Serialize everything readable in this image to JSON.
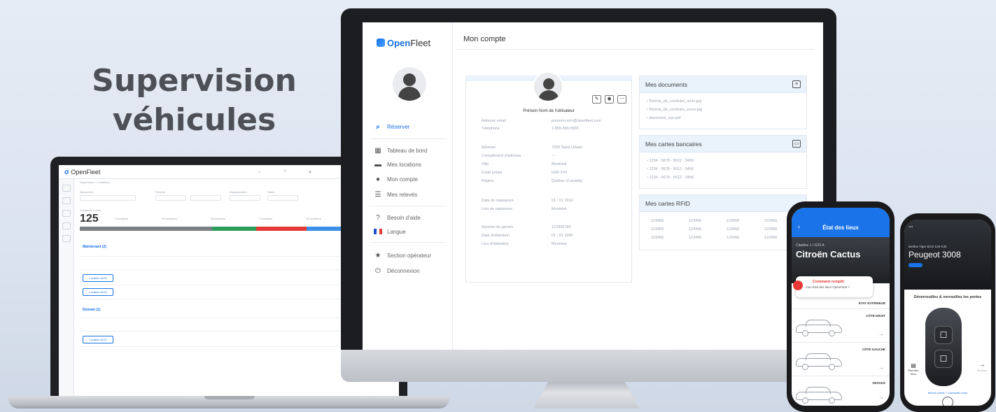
{
  "headline": {
    "line1": "Supervision",
    "line2": "véhicules"
  },
  "colors": {
    "accent": "#1a73e8",
    "danger": "#e53935",
    "text": "#4d5057"
  },
  "desktop": {
    "logo_prefix": "Open",
    "logo_suffix": "Fleet",
    "page_title": "Mon compte",
    "nav": [
      {
        "label": "Réserver",
        "icon": "search-icon"
      },
      {
        "label": "Tableau de bord",
        "icon": "dashboard-icon"
      },
      {
        "label": "Mes locations",
        "icon": "car-icon"
      },
      {
        "label": "Mon compte",
        "icon": "user-icon"
      },
      {
        "label": "Mes relevés",
        "icon": "list-icon"
      },
      {
        "label": "Besoin d'aide",
        "icon": "help-icon"
      },
      {
        "label": "Langue",
        "icon": "flag-icon"
      },
      {
        "label": "Section opérateur",
        "icon": "star-icon"
      },
      {
        "label": "Déconnexion",
        "icon": "power-icon"
      }
    ],
    "profile": {
      "name": "Prénom Nom de l'utilisateur",
      "fields": [
        {
          "label": "Adresse email",
          "value": "prenom.nom@openfleet.com"
        },
        {
          "label": "Téléphone",
          "value": "1-855-555-5555"
        },
        {
          "label": "Adresse",
          "value": "7200 Saint-Urbain"
        },
        {
          "label": "Complément d'adresse",
          "value": "—"
        },
        {
          "label": "Ville",
          "value": "Montréal"
        },
        {
          "label": "Code postal",
          "value": "H2R 2Y6"
        },
        {
          "label": "Région",
          "value": "Québec (Canada)"
        },
        {
          "label": "Date de naissance",
          "value": "01 / 01 1910"
        },
        {
          "label": "Lieu de naissance",
          "value": "Montréal"
        },
        {
          "label": "Numéro du permis",
          "value": "123456789"
        },
        {
          "label": "Date d'obtention",
          "value": "01 / 01 1990"
        },
        {
          "label": "Lieu d'obtention",
          "value": "Montréal"
        }
      ]
    },
    "documents": {
      "title": "Mes documents",
      "items": [
        "Permis_de_conduire_recto.jpg",
        "Permis_de_conduire_verso.jpg",
        "document_xyz.pdf"
      ]
    },
    "cards": {
      "title": "Mes cartes bancaires",
      "items": [
        "1234 - 5678 - 9012 - 3456",
        "1234 - 5678 - 9012 - 3456",
        "1234 - 5678 - 9012 - 3456"
      ]
    },
    "rfid": {
      "title": "Mes cartes RFID",
      "rows": [
        [
          "123456",
          "123456",
          "123456",
          "123456"
        ],
        [
          "123456",
          "123456",
          "123456",
          "123456"
        ],
        [
          "123456",
          "123456",
          "123456",
          "123456"
        ]
      ]
    }
  },
  "laptop": {
    "logo_prefix": "Open",
    "logo_suffix": "Fleet",
    "breadcrumb": "Supervision > Locations",
    "filters": [
      "Recherche",
      "Période",
      "Emplacement",
      "Statut"
    ],
    "count": "125",
    "count_label": "Locations à venir",
    "stats": [
      "3 locations",
      "19 locations",
      "23 locations",
      "2 locations",
      "15 locations",
      "1 location"
    ],
    "sections": [
      {
        "title": "Maintenant (2)",
        "rows": [
          "Location #123",
          "Location #123"
        ]
      },
      {
        "title": "Demain (1)",
        "rows": [
          "Location #123"
        ]
      }
    ]
  },
  "phone_left": {
    "title": "État des lieux",
    "vehicle_sub": "Citadine 1 / G25 A",
    "vehicle_name": "Citroën Cactus",
    "tip_title": "Comment remplir",
    "tip_sub": "mon État des lieux OpenFleet ?",
    "sections": [
      "ÉTAT EXTÉRIEUR",
      "CÔTÉ DROIT",
      "CÔTÉ GAUCHE",
      "DESSUS"
    ]
  },
  "phone_right": {
    "vehicle_sub": "Berline Tiger BCD-125-X35",
    "vehicle_name": "Peugeot 3008",
    "title": "Déverrouillez & verrouillez les portes",
    "left_action": "État des lieux",
    "right_action": "Terminer",
    "footer": "Besoin d'aide ? Contactez-nous"
  }
}
